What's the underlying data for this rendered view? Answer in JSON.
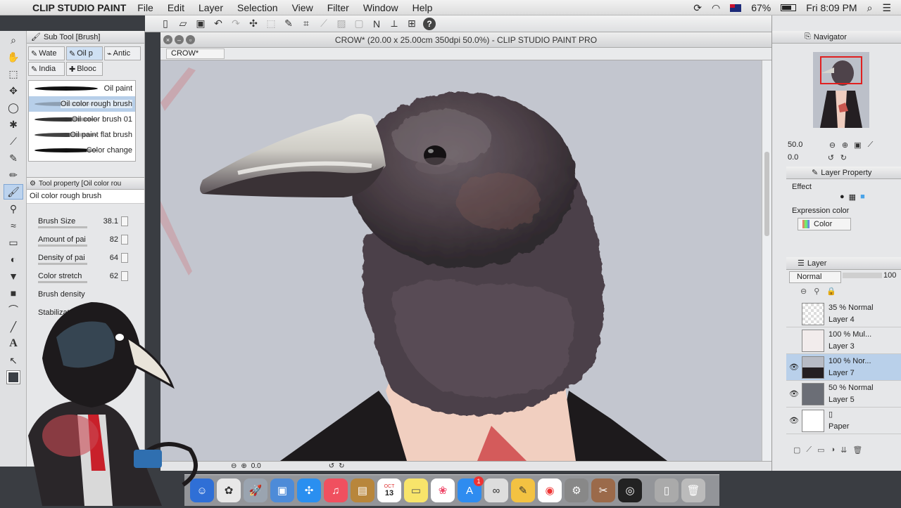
{
  "menubar": {
    "app_name": "CLIP STUDIO PAINT",
    "menus": [
      "File",
      "Edit",
      "Layer",
      "Selection",
      "View",
      "Filter",
      "Window",
      "Help"
    ],
    "battery": "67%",
    "clock": "Fri 8:09 PM"
  },
  "sub_tool": {
    "title": "Sub Tool [Brush]",
    "tabs": [
      "Wate",
      "Oil p",
      "Antic",
      "India",
      "Blooc"
    ],
    "brushes": [
      "Oil paint",
      "Oil color rough brush",
      "Oil color brush 01",
      "Oil paint flat brush",
      "Color change"
    ]
  },
  "tool_property": {
    "title": "Tool property [Oil color rou",
    "tool_name": "Oil color rough brush",
    "props": [
      {
        "label": "Brush Size",
        "value": "38.1"
      },
      {
        "label": "Amount of pai",
        "value": "82"
      },
      {
        "label": "Density of pai",
        "value": "64"
      },
      {
        "label": "Color stretch",
        "value": "62"
      },
      {
        "label": "Brush density",
        "value": ""
      },
      {
        "label": "Stabilizat",
        "value": ""
      }
    ]
  },
  "canvas": {
    "window_title": "CROW* (20.00 x 25.00cm 350dpi 50.0%)  - CLIP STUDIO PAINT PRO",
    "doc_tab": "CROW*",
    "zoom_status": "0.0"
  },
  "navigator": {
    "title": "Navigator",
    "zoom": "50.0",
    "rotation": "0.0"
  },
  "layer_property": {
    "title": "Layer Property",
    "effect_label": "Effect",
    "expression_label": "Expression color",
    "expression_value": "Color"
  },
  "layers": {
    "title": "Layer",
    "blend_mode": "Normal",
    "opacity": "100",
    "items": [
      {
        "blend": "35 % Normal",
        "name": "Layer 4"
      },
      {
        "blend": "100 % Mul...",
        "name": "Layer 3"
      },
      {
        "blend": "100 % Nor...",
        "name": "Layer 7"
      },
      {
        "blend": "50 % Normal",
        "name": "Layer 5"
      },
      {
        "blend": "",
        "name": "Paper"
      }
    ]
  },
  "dock": {
    "calendar_day": "13",
    "calendar_month": "OCT",
    "badge": "1"
  }
}
